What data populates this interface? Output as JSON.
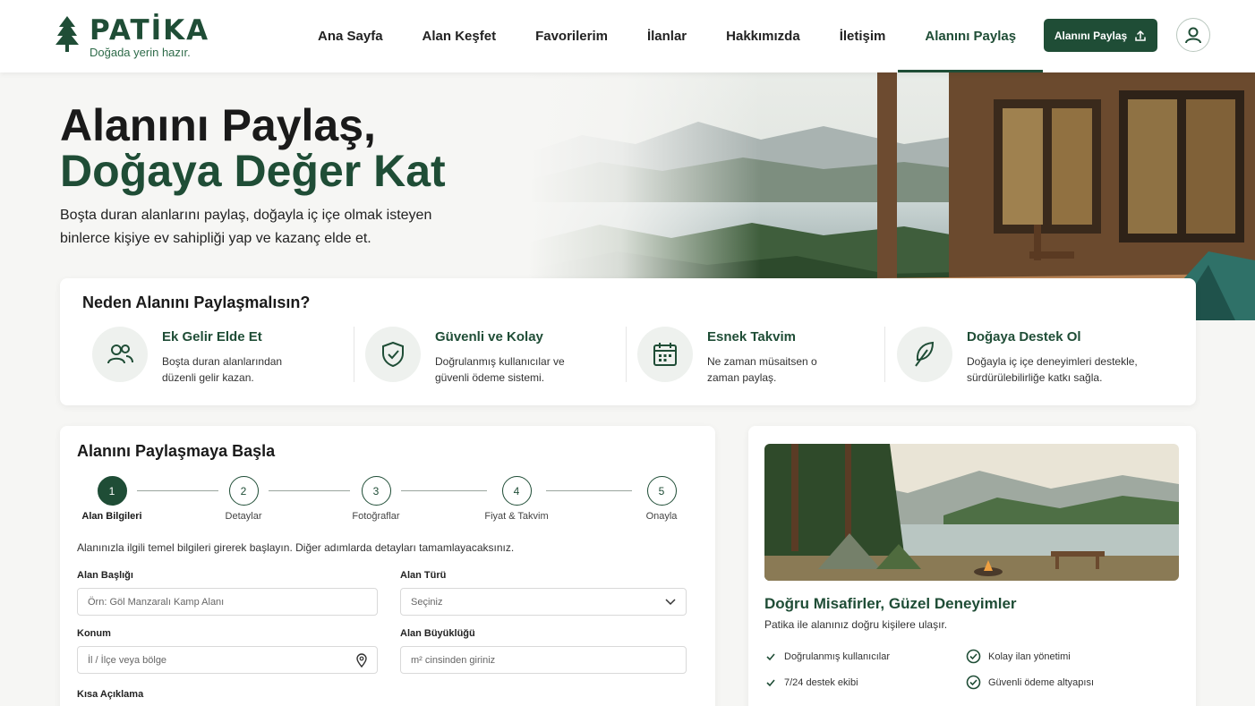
{
  "brand": {
    "name": "PATİKA",
    "tagline": "Doğada yerin hazır.",
    "accent": "#1f4d36"
  },
  "nav": {
    "items": [
      {
        "label": "Ana Sayfa"
      },
      {
        "label": "Alan Keşfet"
      },
      {
        "label": "Favorilerim"
      },
      {
        "label": "İlanlar"
      },
      {
        "label": "Hakkımızda"
      },
      {
        "label": "İletişim"
      },
      {
        "label": "Alanını Paylaş",
        "active": true
      }
    ],
    "share_button": "Alanını Paylaş",
    "share_icon": "upload-icon",
    "avatar_icon": "user-icon"
  },
  "hero": {
    "title_line1": "Alanını Paylaş,",
    "title_line2": "Doğaya Değer Kat",
    "description": "Boşta duran alanlarını paylaş, doğayla iç içe olmak isteyen binlerce kişiye ev sahipliği yap ve kazanç elde et."
  },
  "benefits": {
    "title": "Neden Alanını Paylaşmalısın?",
    "items": [
      {
        "icon": "users-icon",
        "title": "Ek Gelir Elde Et",
        "text": "Boşta duran alanlarından düzenli gelir kazan."
      },
      {
        "icon": "shield-check-icon",
        "title": "Güvenli ve Kolay",
        "text": "Doğrulanmış kullanıcılar ve güvenli ödeme sistemi."
      },
      {
        "icon": "calendar-icon",
        "title": "Esnek Takvim",
        "text": "Ne zaman müsaitsen o zaman paylaş."
      },
      {
        "icon": "leaf-icon",
        "title": "Doğaya Destek Ol",
        "text": "Doğayla iç içe deneyimleri destekle, sürdürülebilirliğe katkı sağla."
      }
    ]
  },
  "form": {
    "title": "Alanını Paylaşmaya Başla",
    "steps": [
      {
        "number": "1",
        "label": "Alan Bilgileri",
        "active": true
      },
      {
        "number": "2",
        "label": "Detaylar"
      },
      {
        "number": "3",
        "label": "Fotoğraflar"
      },
      {
        "number": "4",
        "label": "Fiyat & Takvim"
      },
      {
        "number": "5",
        "label": "Onayla"
      }
    ],
    "description": "Alanınızla ilgili temel bilgileri girerek başlayın. Diğer adımlarda detayları tamamlayacaksınız.",
    "fields": {
      "title_label": "Alan Başlığı",
      "title_placeholder": "Örn: Göl Manzaralı Kamp Alanı",
      "type_label": "Alan Türü",
      "type_value": "Seçiniz",
      "location_label": "Konum",
      "location_placeholder": "İl / İlçe veya bölge",
      "size_label": "Alan Büyüklüğü",
      "size_placeholder": "m² cinsinden giriniz",
      "short_desc_label": "Kısa Açıklama"
    }
  },
  "side": {
    "title": "Doğru Misafirler, Güzel Deneyimler",
    "subtitle": "Patika ile alanınız doğru kişilere ulaşır.",
    "features": [
      {
        "text": "Doğrulanmış kullanıcılar"
      },
      {
        "text": "Kolay ilan yönetimi"
      },
      {
        "text": "7/24 destek ekibi"
      },
      {
        "text": "Güvenli ödeme altyapısı"
      }
    ]
  }
}
